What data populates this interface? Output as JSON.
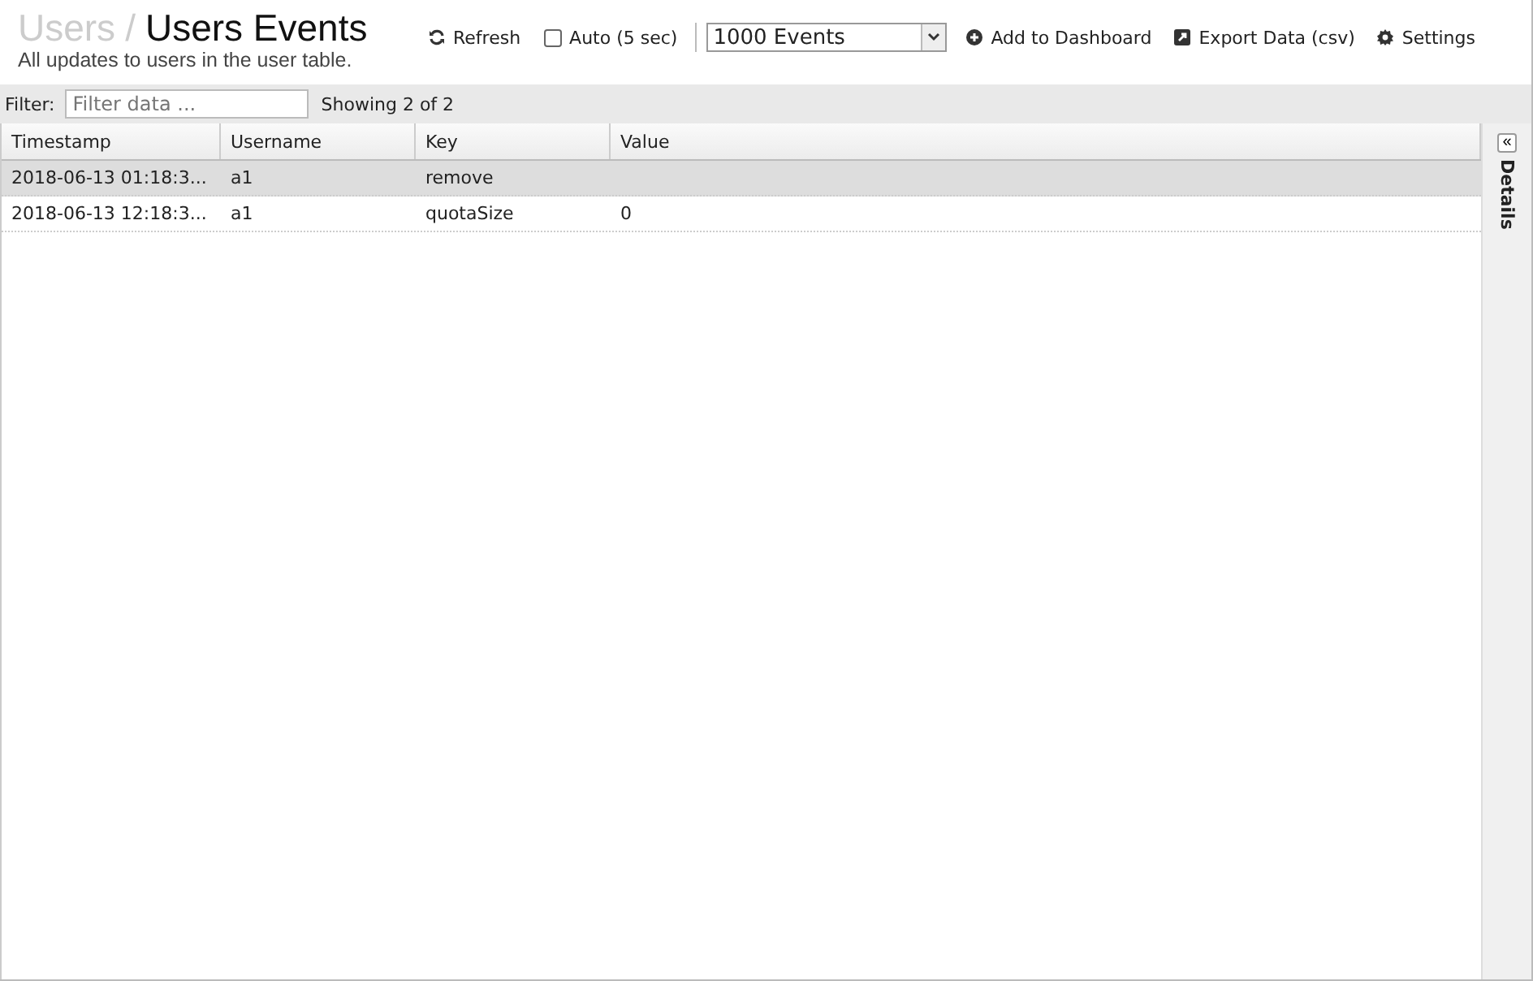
{
  "breadcrumb": {
    "parent": "Users",
    "separator": "/",
    "title": "Users Events"
  },
  "subtitle": "All updates to users in the user table.",
  "toolbar": {
    "refresh": "Refresh",
    "auto": {
      "label": "Auto (5 sec)",
      "checked": false
    },
    "limit": "1000 Events",
    "add": "Add to Dashboard",
    "export": "Export Data (csv)",
    "settings": "Settings"
  },
  "filter": {
    "label": "Filter:",
    "placeholder": "Filter data ...",
    "count": "Showing 2 of 2"
  },
  "table": {
    "columns": [
      "Timestamp",
      "Username",
      "Key",
      "Value"
    ],
    "rows": [
      {
        "cells": [
          "2018-06-13 01:18:3...",
          "a1",
          "remove",
          ""
        ],
        "selected": true
      },
      {
        "cells": [
          "2018-06-13 12:18:3...",
          "a1",
          "quotaSize",
          "0"
        ],
        "selected": false
      }
    ]
  },
  "details_panel": {
    "toggle": "«",
    "label": "Details"
  }
}
